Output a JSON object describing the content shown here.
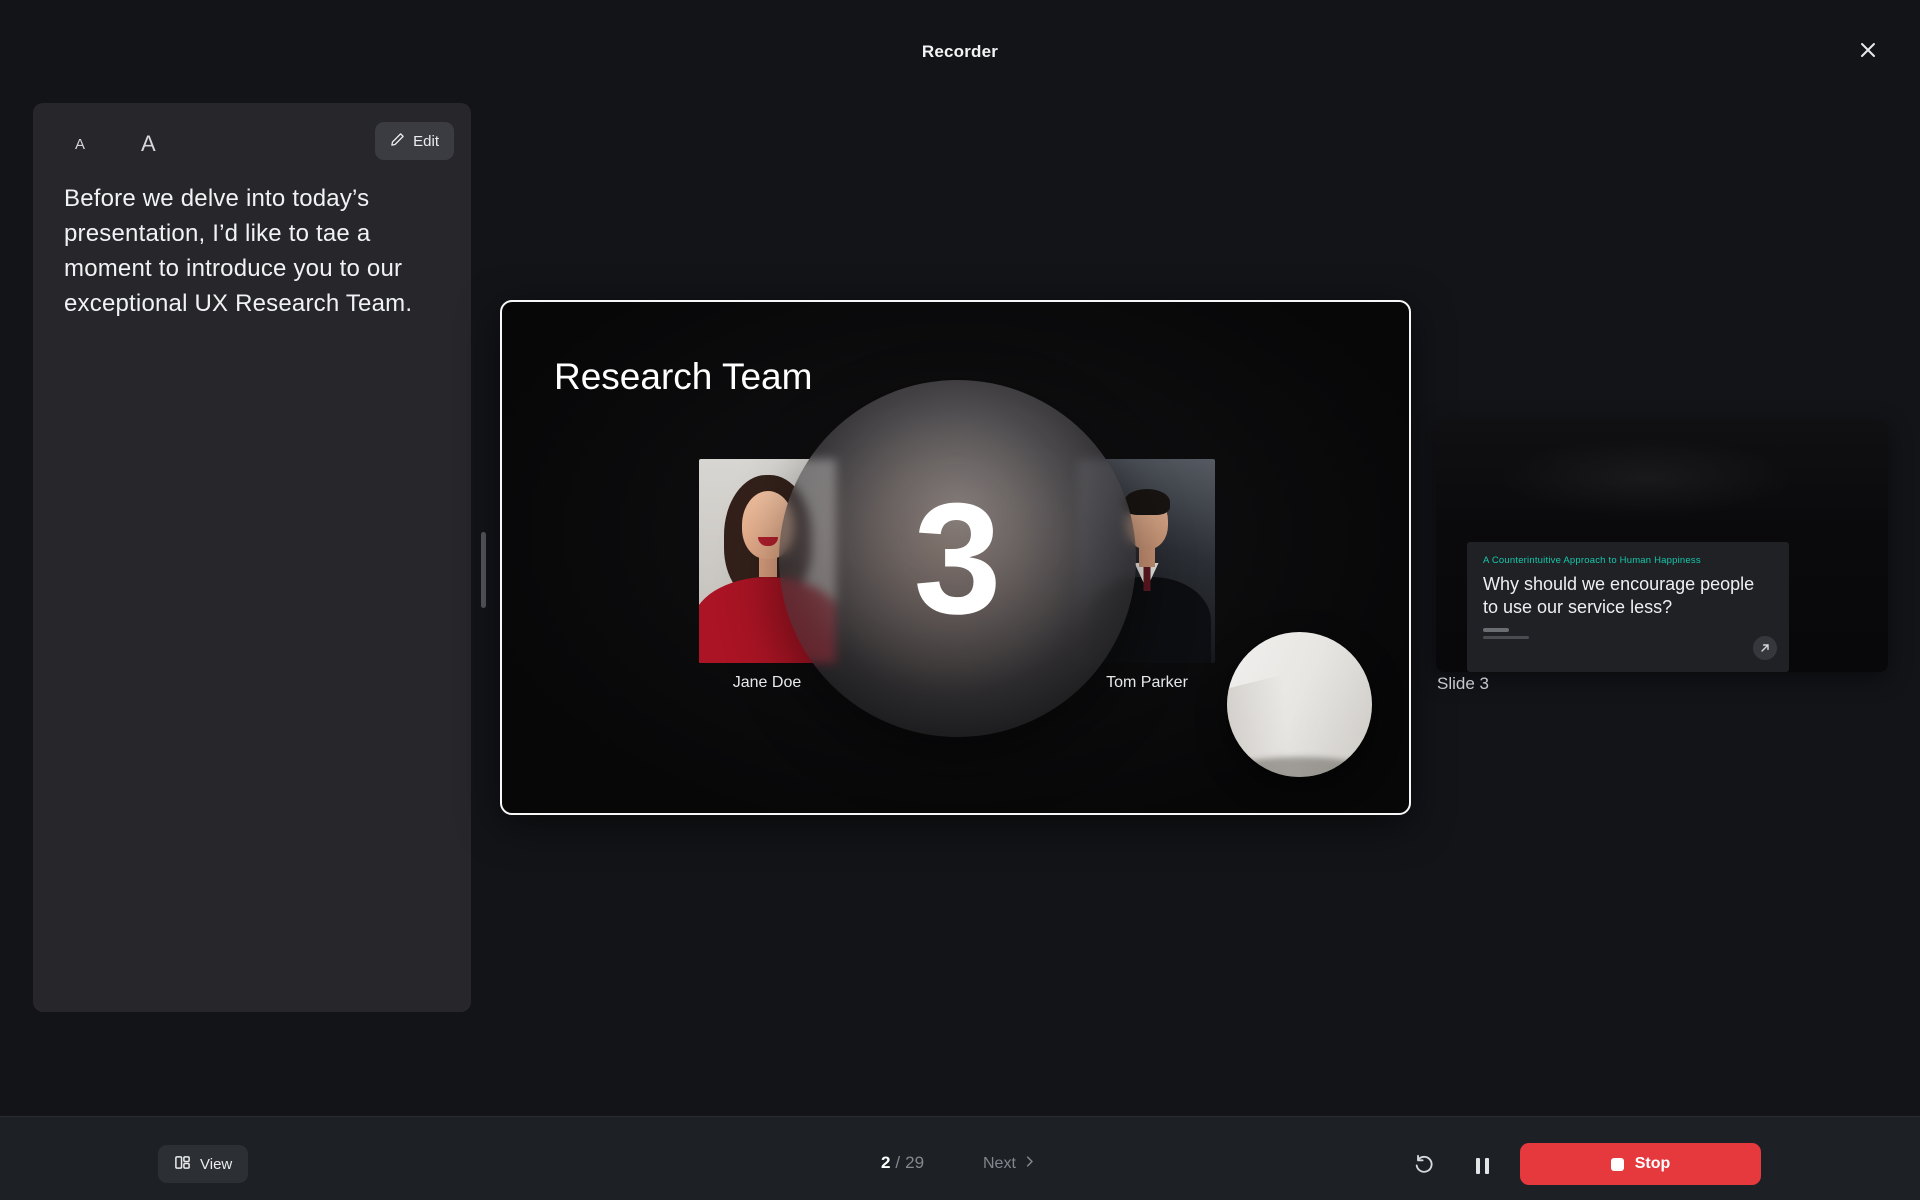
{
  "header": {
    "title": "Recorder"
  },
  "teleprompter": {
    "font_size_small": "A",
    "font_size_large": "A",
    "edit_button": "Edit",
    "script": "Before we delve into today’s presentation, I’d like to tae a moment to introduce you to our exceptional UX Research Team."
  },
  "slide": {
    "title": "Research Team",
    "countdown": "3",
    "members": [
      {
        "name": "Jane Doe"
      },
      {
        "name": "Tom Parker"
      }
    ]
  },
  "next_slide_panel": {
    "eyebrow": "A Counterintuitive Approach to Human Happiness",
    "question": "Why should we encourage people to use our service less?",
    "caption": "Slide 3"
  },
  "footer": {
    "view_button": "View",
    "current_slide": "2",
    "separator": "/",
    "total_slides": "29",
    "next_button": "Next",
    "stop_button": "Stop"
  },
  "icons": {
    "close": "close-icon",
    "pencil": "pencil-icon",
    "view_layout": "view-layout-icon",
    "chevron_right": "chevron-right-icon",
    "restart": "restart-icon",
    "pause": "pause-icon",
    "stop_square": "stop-square-icon",
    "share_arrow": "share-arrow-icon"
  },
  "colors": {
    "background": "#131418",
    "panel": "#26262b",
    "footer_bar": "#1d2126",
    "accent_red": "#e5393e",
    "teal_accent": "#16c7ab",
    "slide_border": "#f7f7f7"
  }
}
